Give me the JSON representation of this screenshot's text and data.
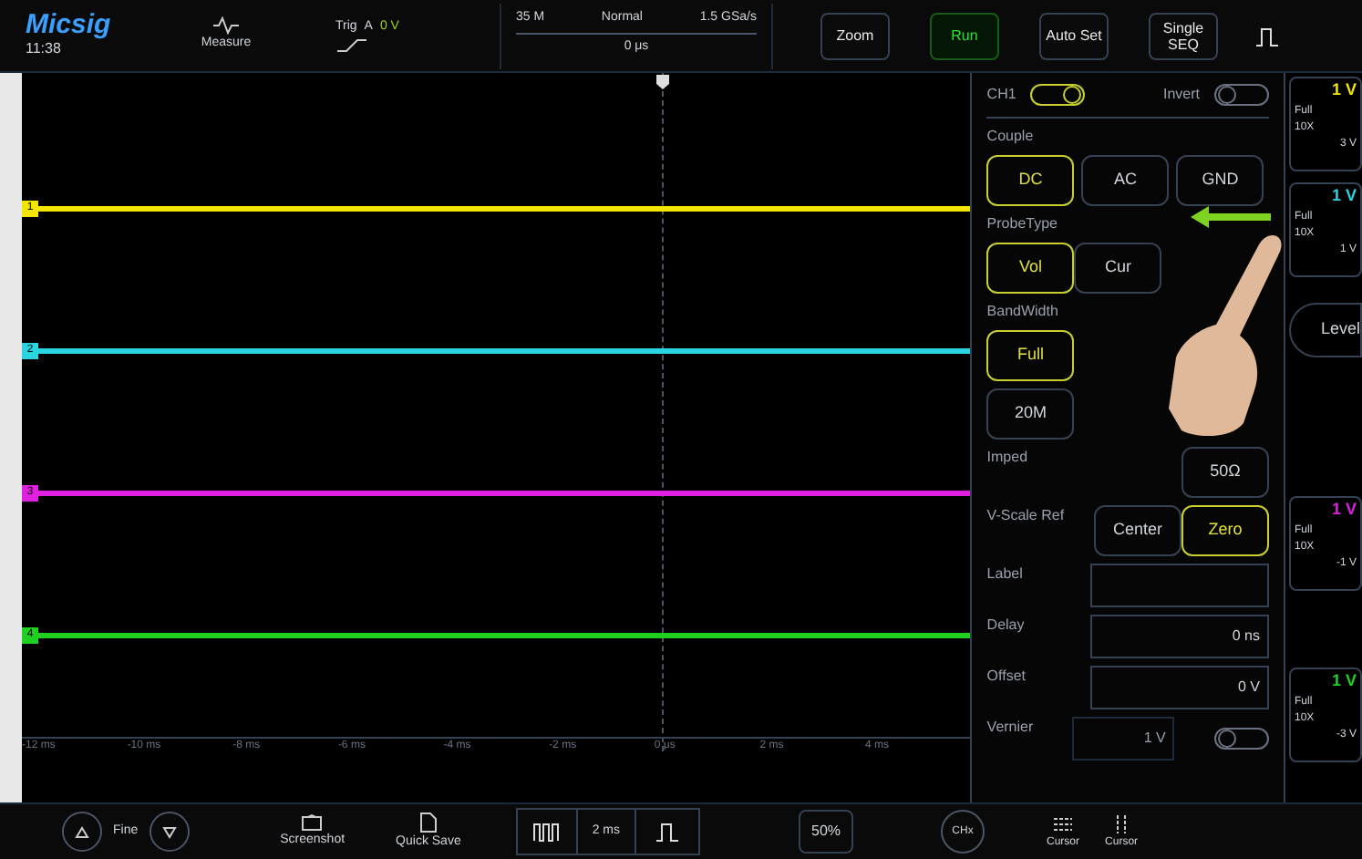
{
  "header": {
    "logo": "Micsig",
    "time": "11:38",
    "measure": "Measure",
    "trigger": {
      "label": "Trig",
      "source": "A",
      "level": "0 V"
    },
    "timebase": {
      "memory": "35 M",
      "mode": "Normal",
      "rate": "1.5 GSa/s",
      "position": "0 μs"
    },
    "buttons": [
      {
        "label": "Zoom",
        "kind": "plain"
      },
      {
        "label": "Run",
        "kind": "run"
      },
      {
        "label": "Auto Set",
        "kind": "plain"
      },
      {
        "label": "Single SEQ",
        "kind": "plain"
      }
    ]
  },
  "traces": [
    {
      "marker": "1",
      "color": "#f2e600"
    },
    {
      "marker": "2",
      "color": "#2ad4e0"
    },
    {
      "marker": "3",
      "color": "#e020e0"
    },
    {
      "marker": "4",
      "color": "#20d020"
    }
  ],
  "time_axis": [
    "-12 ms",
    "-10 ms",
    "-8 ms",
    "-6 ms",
    "-4 ms",
    "-2 ms",
    "0 μs",
    "2 ms",
    "4 ms"
  ],
  "ch_panel": {
    "channel": {
      "label": "CH1",
      "on": true
    },
    "invert": {
      "label": "Invert",
      "on": false
    },
    "couple": {
      "label": "Couple",
      "options": [
        {
          "label": "DC",
          "selected": true
        },
        {
          "label": "AC",
          "selected": false
        },
        {
          "label": "GND",
          "selected": false
        }
      ]
    },
    "probe_type": {
      "label": "ProbeType",
      "options": [
        {
          "label": "Vol",
          "selected": true
        },
        {
          "label": "Cur",
          "selected": false
        }
      ]
    },
    "bandwidth": {
      "label": "BandWidth",
      "rows": [
        [
          {
            "label": "Full",
            "selected": true
          }
        ],
        [
          {
            "label": "20M",
            "selected": false
          }
        ]
      ]
    },
    "imped": {
      "label": "Imped",
      "options": [
        {
          "label": "50Ω",
          "selected": false
        }
      ]
    },
    "vscale_ref": {
      "label": "V-Scale Ref",
      "options": [
        {
          "label": "Center",
          "selected": false
        },
        {
          "label": "Zero",
          "selected": true
        }
      ]
    },
    "fields": [
      {
        "label": "Label"
      },
      {
        "label": "Delay",
        "value": "0 ns"
      },
      {
        "label": "Offset",
        "value": "0 V"
      }
    ],
    "vernier": {
      "label": "Vernier",
      "value": "1 V",
      "disabled": true,
      "on": false
    }
  },
  "channel_cards": [
    {
      "scale": "1 V",
      "color": "#f2e600",
      "bandwidth": "Full",
      "probe": "10X",
      "offset": "3 V"
    },
    {
      "scale": "1 V",
      "color": "#2ad4e0",
      "bandwidth": "Full",
      "probe": "10X",
      "offset": "1 V"
    },
    {
      "scale": "1 V",
      "color": "#e020e0",
      "bandwidth": "Full",
      "probe": "10X",
      "offset": "-1 V"
    },
    {
      "scale": "1 V",
      "color": "#20d020",
      "bandwidth": "Full",
      "probe": "10X",
      "offset": "-3 V"
    }
  ],
  "level_button": "Level",
  "footer": {
    "fine": "Fine",
    "screenshot": "Screenshot",
    "quick_save": "Quick Save",
    "timebase": "2 ms",
    "trigger_percent": "50%",
    "chx": "CHx",
    "cursors": [
      "Cursor",
      "Cursor"
    ]
  }
}
